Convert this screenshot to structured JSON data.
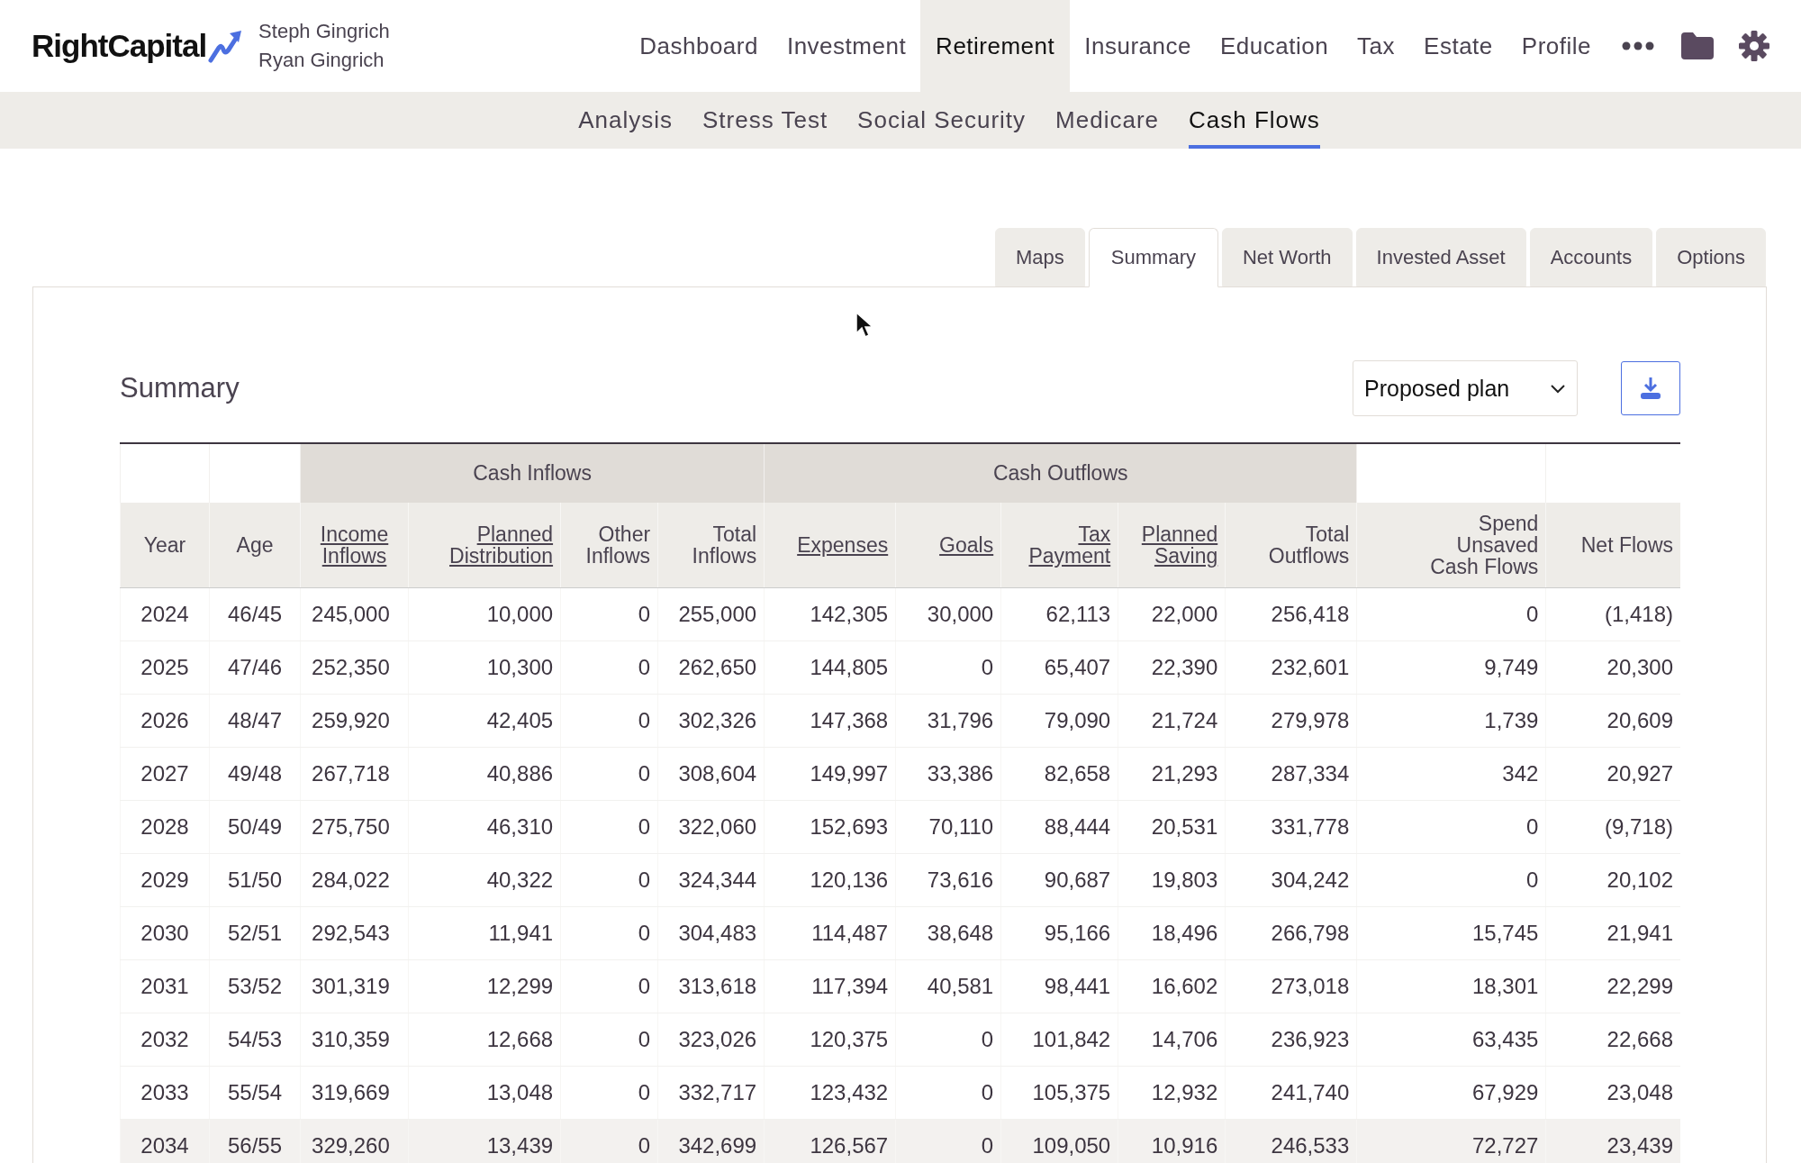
{
  "header": {
    "logo": "RightCapital",
    "clients": [
      "Steph Gingrich",
      "Ryan Gingrich"
    ],
    "nav": [
      {
        "label": "Dashboard",
        "selected": false
      },
      {
        "label": "Investment",
        "selected": false
      },
      {
        "label": "Retirement",
        "selected": true
      },
      {
        "label": "Insurance",
        "selected": false
      },
      {
        "label": "Education",
        "selected": false
      },
      {
        "label": "Tax",
        "selected": false
      },
      {
        "label": "Estate",
        "selected": false
      },
      {
        "label": "Profile",
        "selected": false
      }
    ]
  },
  "subnav": [
    {
      "label": "Analysis",
      "selected": false
    },
    {
      "label": "Stress Test",
      "selected": false
    },
    {
      "label": "Social Security",
      "selected": false
    },
    {
      "label": "Medicare",
      "selected": false
    },
    {
      "label": "Cash Flows",
      "selected": true
    }
  ],
  "view_tabs": [
    {
      "label": "Maps",
      "selected": false
    },
    {
      "label": "Summary",
      "selected": true
    },
    {
      "label": "Net Worth",
      "selected": false
    },
    {
      "label": "Invested Asset",
      "selected": false
    },
    {
      "label": "Accounts",
      "selected": false
    },
    {
      "label": "Options",
      "selected": false
    }
  ],
  "summary": {
    "title": "Summary",
    "plan_select": "Proposed plan",
    "table": {
      "column_groups": [
        {
          "colspan": 2
        },
        {
          "label": "Cash Inflows",
          "colspan": 4
        },
        {
          "label": "Cash Outflows",
          "colspan": 5
        }
      ],
      "columns": [
        {
          "label": "Year",
          "sortable": false
        },
        {
          "label": "Age",
          "sortable": false
        },
        {
          "label": "Income Inflows",
          "sortable": true
        },
        {
          "label": "Planned Distribution",
          "sortable": true
        },
        {
          "label": "Other Inflows",
          "sortable": false
        },
        {
          "label": "Total Inflows",
          "sortable": false
        },
        {
          "label": "Expenses",
          "sortable": true
        },
        {
          "label": "Goals",
          "sortable": true
        },
        {
          "label": "Tax Payment",
          "sortable": true
        },
        {
          "label": "Planned Saving",
          "sortable": true
        },
        {
          "label": "Total Outflows",
          "sortable": false
        },
        {
          "label": "Spend Unsaved Cash Flows",
          "sortable": false
        },
        {
          "label": "Net Flows",
          "sortable": false
        }
      ],
      "rows": [
        {
          "hovered": false,
          "cells": [
            "2024",
            "46/45",
            "245,000",
            "10,000",
            "0",
            "255,000",
            "142,305",
            "30,000",
            "62,113",
            "22,000",
            "256,418",
            "0",
            "(1,418)"
          ]
        },
        {
          "hovered": false,
          "cells": [
            "2025",
            "47/46",
            "252,350",
            "10,300",
            "0",
            "262,650",
            "144,805",
            "0",
            "65,407",
            "22,390",
            "232,601",
            "9,749",
            "20,300"
          ]
        },
        {
          "hovered": false,
          "cells": [
            "2026",
            "48/47",
            "259,920",
            "42,405",
            "0",
            "302,326",
            "147,368",
            "31,796",
            "79,090",
            "21,724",
            "279,978",
            "1,739",
            "20,609"
          ]
        },
        {
          "hovered": false,
          "cells": [
            "2027",
            "49/48",
            "267,718",
            "40,886",
            "0",
            "308,604",
            "149,997",
            "33,386",
            "82,658",
            "21,293",
            "287,334",
            "342",
            "20,927"
          ]
        },
        {
          "hovered": false,
          "cells": [
            "2028",
            "50/49",
            "275,750",
            "46,310",
            "0",
            "322,060",
            "152,693",
            "70,110",
            "88,444",
            "20,531",
            "331,778",
            "0",
            "(9,718)"
          ]
        },
        {
          "hovered": false,
          "cells": [
            "2029",
            "51/50",
            "284,022",
            "40,322",
            "0",
            "324,344",
            "120,136",
            "73,616",
            "90,687",
            "19,803",
            "304,242",
            "0",
            "20,102"
          ]
        },
        {
          "hovered": false,
          "cells": [
            "2030",
            "52/51",
            "292,543",
            "11,941",
            "0",
            "304,483",
            "114,487",
            "38,648",
            "95,166",
            "18,496",
            "266,798",
            "15,745",
            "21,941"
          ]
        },
        {
          "hovered": false,
          "cells": [
            "2031",
            "53/52",
            "301,319",
            "12,299",
            "0",
            "313,618",
            "117,394",
            "40,581",
            "98,441",
            "16,602",
            "273,018",
            "18,301",
            "22,299"
          ]
        },
        {
          "hovered": false,
          "cells": [
            "2032",
            "54/53",
            "310,359",
            "12,668",
            "0",
            "323,026",
            "120,375",
            "0",
            "101,842",
            "14,706",
            "236,923",
            "63,435",
            "22,668"
          ]
        },
        {
          "hovered": false,
          "cells": [
            "2033",
            "55/54",
            "319,669",
            "13,048",
            "0",
            "332,717",
            "123,432",
            "0",
            "105,375",
            "12,932",
            "241,740",
            "67,929",
            "23,048"
          ]
        },
        {
          "hovered": true,
          "cells": [
            "2034",
            "56/55",
            "329,260",
            "13,439",
            "0",
            "342,699",
            "126,567",
            "0",
            "109,050",
            "10,916",
            "246,533",
            "72,727",
            "23,439"
          ]
        }
      ]
    }
  }
}
